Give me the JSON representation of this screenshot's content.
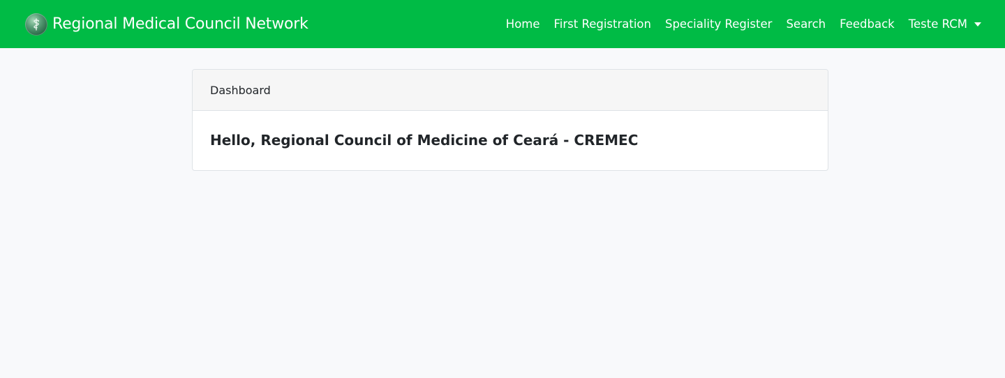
{
  "app": {
    "brand_title": "Regional Medical Council Network",
    "brand_icon": "medical-caduceus-icon",
    "accent_color": "#00bb45",
    "background_color": "#f8f9fb"
  },
  "nav": {
    "items": [
      {
        "label": "Home"
      },
      {
        "label": "First Registration"
      },
      {
        "label": "Speciality Register"
      },
      {
        "label": "Search"
      },
      {
        "label": "Feedback"
      }
    ],
    "user_menu": {
      "label": "Teste RCM",
      "icon": "chevron-down-icon"
    }
  },
  "dashboard": {
    "header": "Dashboard",
    "greeting": "Hello, Regional Council of Medicine of Ceará - CREMEC"
  }
}
